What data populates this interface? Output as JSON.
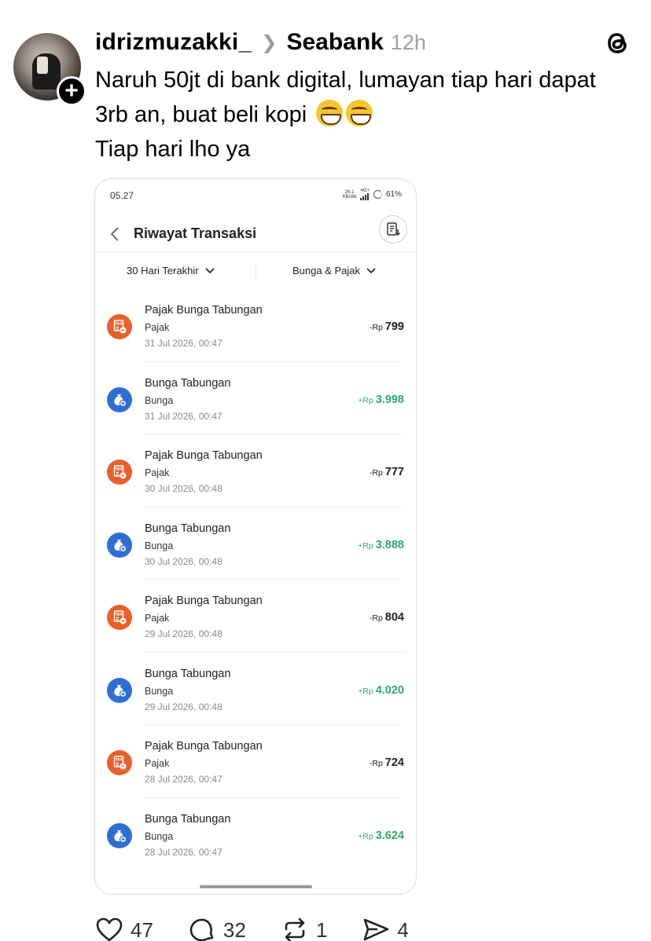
{
  "post": {
    "username": "idrizmuzakki_",
    "community": "Seabank",
    "time": "12h",
    "text_line1": "Naruh 50jt di bank digital, lumayan tiap hari dapat",
    "text_line2": "3rb an, buat beli kopi",
    "text_line3": "Tiap hari lho ya"
  },
  "phone": {
    "status_time": "05.27",
    "net_speed": "26,1",
    "net_unit": "KB/dtk",
    "net_type": "4G+",
    "battery": "61%",
    "title": "Riwayat Transaksi",
    "filter_period": "30 Hari Terakhir",
    "filter_type": "Bunga & Pajak",
    "transactions": [
      {
        "name": "Pajak Bunga Tabungan",
        "category": "Pajak",
        "date": "31 Jul 2026, 00:47",
        "sign_currency": "-Rp",
        "amount": "799",
        "kind": "tax"
      },
      {
        "name": "Bunga Tabungan",
        "category": "Bunga",
        "date": "31 Jul 2026, 00:47",
        "sign_currency": "+Rp",
        "amount": "3.998",
        "kind": "interest"
      },
      {
        "name": "Pajak Bunga Tabungan",
        "category": "Pajak",
        "date": "30 Jul 2026, 00:48",
        "sign_currency": "-Rp",
        "amount": "777",
        "kind": "tax"
      },
      {
        "name": "Bunga Tabungan",
        "category": "Bunga",
        "date": "30 Jul 2026, 00:48",
        "sign_currency": "+Rp",
        "amount": "3.888",
        "kind": "interest"
      },
      {
        "name": "Pajak Bunga Tabungan",
        "category": "Pajak",
        "date": "29 Jul 2026, 00:48",
        "sign_currency": "-Rp",
        "amount": "804",
        "kind": "tax"
      },
      {
        "name": "Bunga Tabungan",
        "category": "Bunga",
        "date": "29 Jul 2026, 00:48",
        "sign_currency": "+Rp",
        "amount": "4.020",
        "kind": "interest"
      },
      {
        "name": "Pajak Bunga Tabungan",
        "category": "Pajak",
        "date": "28 Jul 2026, 00:47",
        "sign_currency": "-Rp",
        "amount": "724",
        "kind": "tax"
      },
      {
        "name": "Bunga Tabungan",
        "category": "Bunga",
        "date": "28 Jul 2026, 00:47",
        "sign_currency": "+Rp",
        "amount": "3.624",
        "kind": "interest"
      }
    ]
  },
  "actions": {
    "likes": "47",
    "replies": "32",
    "reposts": "1",
    "shares": "4"
  },
  "colors": {
    "tax_icon": "#e8612c",
    "interest_icon": "#2e6fd6",
    "positive_amount": "#2fa86b"
  },
  "icons": [
    "threads-logo-icon",
    "chevron-right-icon",
    "back-arrow-icon",
    "download-statement-icon",
    "chevron-down-icon",
    "tax-icon",
    "money-bag-icon",
    "heart-icon",
    "comment-icon",
    "repost-icon",
    "share-icon",
    "plus-icon"
  ]
}
